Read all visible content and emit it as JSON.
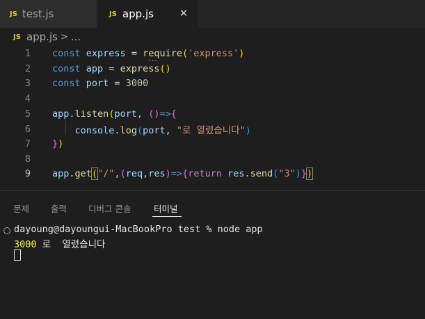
{
  "tabs": [
    {
      "badge": "JS",
      "label": "test.js",
      "active": false
    },
    {
      "badge": "JS",
      "label": "app.js",
      "active": true,
      "close": "✕"
    }
  ],
  "breadcrumb": {
    "badge": "JS",
    "file": "app.js",
    "separator": ">",
    "more": "..."
  },
  "editor": {
    "line_numbers": [
      "1",
      "2",
      "3",
      "4",
      "5",
      "6",
      "7",
      "8",
      "9"
    ],
    "current_line": "9",
    "hover_dots": "...",
    "lines": [
      "const express = require('express')",
      "const app = express()",
      "const port = 3000",
      "",
      "app.listen(port, ()=>{",
      "    console.log(port, \"로 열렸습니다\")",
      "})",
      "",
      "app.get(\"/\",(req,res)=>{return res.send(\"3\")})"
    ]
  },
  "panel": {
    "tabs": [
      "문제",
      "출력",
      "디버그 콘솔",
      "터미널"
    ],
    "active_tab": "터미널"
  },
  "terminal": {
    "prompt": "dayoung@dayoungui-MacBookPro test % node app",
    "output_number": "3000",
    "output_text": " 로  열렸습니다"
  },
  "colors": {
    "keyword": "#569cd6",
    "variable": "#9cdcfe",
    "function": "#dcdcaa",
    "string": "#ce9178",
    "number": "#b5cea8",
    "js_badge": "#cbcb41",
    "terminal_highlight": "#f5f543"
  },
  "icons": [
    "js-file-icon",
    "close-icon",
    "chevron-right-icon",
    "terminal-circle-icon",
    "terminal-cursor-icon"
  ]
}
